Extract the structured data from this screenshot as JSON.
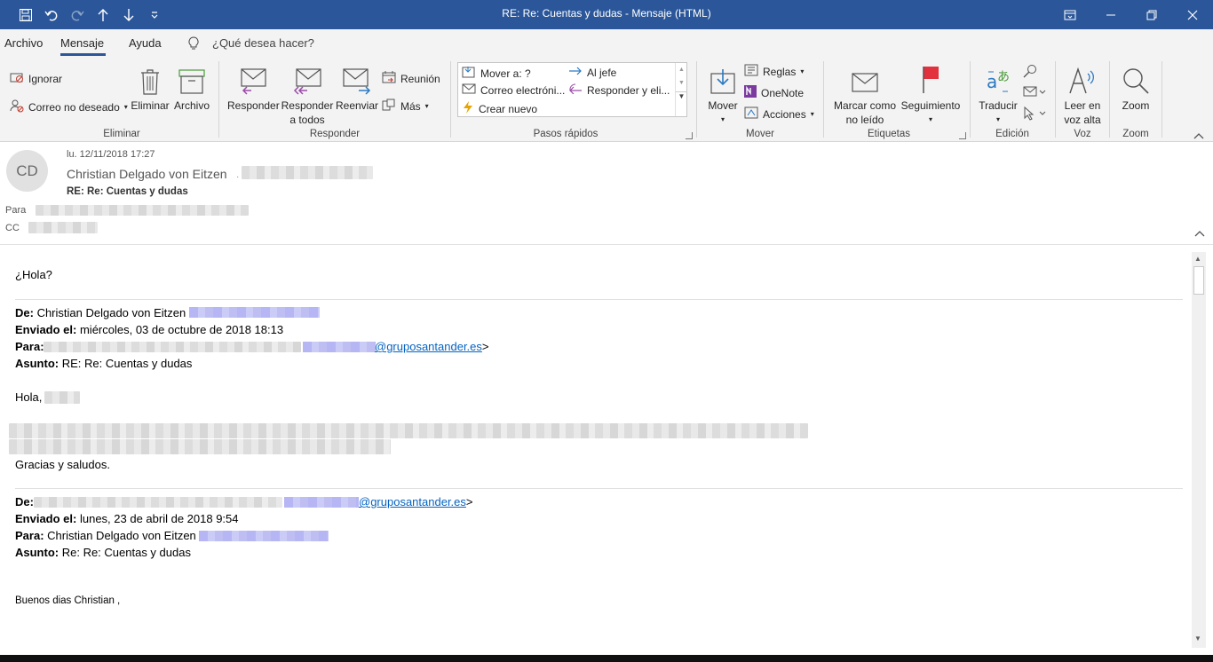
{
  "window": {
    "title": "RE: Re: Cuentas y dudas  -  Mensaje (HTML)"
  },
  "quick_access": [
    "save-icon",
    "undo-icon",
    "redo-icon",
    "up-arrow-icon",
    "down-arrow-icon",
    "customize-icon"
  ],
  "menu": {
    "tabs": [
      "Archivo",
      "Mensaje",
      "Ayuda"
    ],
    "active_tab": "Mensaje",
    "tell_me": "¿Qué desea hacer?"
  },
  "ribbon": {
    "eliminar": {
      "label": "Eliminar",
      "ignorar": "Ignorar",
      "junk": "Correo no deseado",
      "delete": "Eliminar",
      "archive": "Archivo"
    },
    "responder": {
      "label": "Responder",
      "reply": "Responder",
      "reply_all_1": "Responder",
      "reply_all_2": "a todos",
      "forward": "Reenviar",
      "meeting": "Reunión",
      "more": "Más"
    },
    "quicksteps": {
      "label": "Pasos rápidos",
      "items": [
        "Mover a: ?",
        "Al jefe",
        "Correo electróni...",
        "Responder y eli...",
        "Crear nuevo"
      ]
    },
    "mover": {
      "label": "Mover",
      "move": "Mover",
      "rules": "Reglas",
      "onenote": "OneNote",
      "actions": "Acciones"
    },
    "etiquetas": {
      "label": "Etiquetas",
      "mark_unread_1": "Marcar como",
      "mark_unread_2": "no leído",
      "followup": "Seguimiento"
    },
    "edicion": {
      "label": "Edición",
      "translate": "Traducir"
    },
    "voz": {
      "label": "Voz",
      "read_aloud_1": "Leer en",
      "read_aloud_2": "voz alta"
    },
    "zoom": {
      "label": "Zoom",
      "zoom": "Zoom"
    }
  },
  "header": {
    "initials": "CD",
    "date": "lu. 12/11/2018 17:27",
    "sender": "Christian Delgado von Eitzen",
    "subject": "RE: Re: Cuentas y dudas",
    "to_label": "Para",
    "cc_label": "CC"
  },
  "body": {
    "greeting": "¿Hola?",
    "msg1": {
      "de_label": "De:",
      "de": " Christian Delgado von Eitzen",
      "enviado_label": "Enviado el:",
      "enviado": " miércoles, 03 de octubre de 2018 18:13",
      "para_label": "Para:",
      "para_link": "@gruposantander.es",
      "para_tail": ">",
      "asunto_label": "Asunto:",
      "asunto": " RE: Re: Cuentas y dudas",
      "hola": "Hola,",
      "closing": "Gracias y saludos."
    },
    "msg2": {
      "de_label": "De:",
      "de_link": "@gruposantander.es",
      "de_tail": ">",
      "enviado_label": "Enviado el:",
      "enviado": " lunes, 23 de abril de 2018 9:54",
      "para_label": "Para:",
      "para": " Christian Delgado von Eitzen",
      "asunto_label": "Asunto:",
      "asunto": " Re: Re: Cuentas y dudas",
      "greeting": "Buenos dias Christian ,"
    }
  },
  "colors": {
    "titlebar": "#2b579a",
    "ribbon": "#f3f3f3",
    "link": "#0563c1",
    "flag": "#e2303d"
  }
}
